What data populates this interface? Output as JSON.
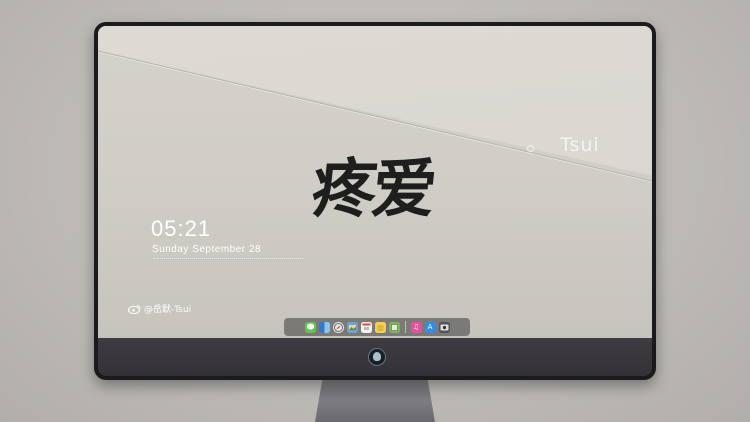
{
  "lockscreen": {
    "time": "05:21",
    "date": "Sunday September  28",
    "signature": "Tsui",
    "calligraphy": "疼爱",
    "weibo_handle": "@岳默-Tsui"
  },
  "dock": {
    "apps": [
      {
        "name": "messages",
        "glyph": "",
        "color": "#5ac84a"
      },
      {
        "name": "finder",
        "glyph": "",
        "color": "#3d86d8"
      },
      {
        "name": "safari",
        "glyph": "",
        "color": "#e6e6e6"
      },
      {
        "name": "photos",
        "glyph": "",
        "color": "#6fa3d6"
      },
      {
        "name": "calendar",
        "glyph": "",
        "color": "#f2f2f2"
      },
      {
        "name": "notes",
        "glyph": "",
        "color": "#f6d24a"
      },
      {
        "name": "preview",
        "glyph": "",
        "color": "#7db35a"
      },
      {
        "name": "music",
        "glyph": "♫",
        "color": "#e6509a"
      },
      {
        "name": "app-store",
        "glyph": "A",
        "color": "#2e8ee8"
      },
      {
        "name": "camera",
        "glyph": "",
        "color": "#555559"
      }
    ]
  },
  "colors": {
    "bezel": "#1b1a1d",
    "chin": "#3a383d",
    "background": "#c2bfba"
  }
}
